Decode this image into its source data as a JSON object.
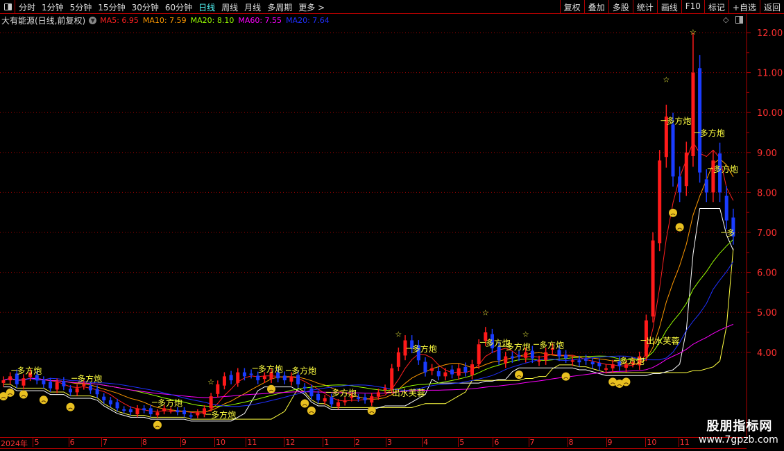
{
  "toolbar": {
    "periods": [
      "分时",
      "1分钟",
      "5分钟",
      "15分钟",
      "30分钟",
      "60分钟",
      "日线",
      "周线",
      "月线",
      "多周期",
      "更多 >"
    ],
    "active_period": "日线",
    "right_buttons": [
      "复权",
      "叠加",
      "多股",
      "统计",
      "画线",
      "F10",
      "标记",
      "+自选",
      "返回"
    ]
  },
  "title": {
    "stock": "大有能源(日线,前复权)",
    "ma": [
      {
        "text": "MA5: 6.95",
        "color": "#ff2020"
      },
      {
        "text": "MA10: 7.59",
        "color": "#ff9900"
      },
      {
        "text": "MA20: 8.10",
        "color": "#99ff00"
      },
      {
        "text": "MA60: 7.55",
        "color": "#ff00ff"
      },
      {
        "text": "MA20: 7.64",
        "color": "#2030ff"
      }
    ]
  },
  "watermark": {
    "cn": "股朋指标网",
    "url": "www.7gpzb.com"
  },
  "chart_data": {
    "type": "candlestick",
    "ylim": [
      2.2,
      12.4
    ],
    "y_ticks": [
      "12.00",
      "11.00",
      "10.00",
      "9.00",
      "8.00",
      "7.00",
      "6.00",
      "5.00",
      "4.00"
    ],
    "y_tick_values": [
      12,
      11,
      10,
      9,
      8,
      7,
      6,
      5,
      4
    ],
    "grid": "horizontal dotted",
    "x_month_labels": [
      {
        "label": "2024年",
        "bar": 0
      },
      {
        "label": "5",
        "bar": 4.4
      },
      {
        "label": "6",
        "bar": 9.7
      },
      {
        "label": "7",
        "bar": 14.6
      },
      {
        "label": "8",
        "bar": 20.5
      },
      {
        "label": "9",
        "bar": 26.4
      },
      {
        "label": "10",
        "bar": 31.5
      },
      {
        "label": "11",
        "bar": 36.2
      },
      {
        "label": "12",
        "bar": 41.9
      },
      {
        "label": "1",
        "bar": 47.7
      },
      {
        "label": "2",
        "bar": 52.3
      },
      {
        "label": "3",
        "bar": 57.1
      },
      {
        "label": "4",
        "bar": 62.5
      },
      {
        "label": "5",
        "bar": 67.9
      },
      {
        "label": "6",
        "bar": 73.1
      },
      {
        "label": "7",
        "bar": 78.4
      },
      {
        "label": "8",
        "bar": 84.2
      },
      {
        "label": "9",
        "bar": 90
      },
      {
        "label": "10",
        "bar": 95.9
      },
      {
        "label": "11",
        "bar": 100.8
      }
    ],
    "close": [
      3.3,
      3.4,
      3.2,
      3.35,
      3.5,
      3.3,
      3.2,
      3.1,
      3.25,
      3.15,
      3.0,
      3.1,
      3.2,
      3.05,
      2.95,
      2.8,
      2.7,
      2.6,
      2.55,
      2.5,
      2.6,
      2.55,
      2.45,
      2.5,
      2.6,
      2.55,
      2.5,
      2.45,
      2.4,
      2.5,
      2.6,
      2.9,
      3.2,
      3.4,
      3.3,
      3.5,
      3.4,
      3.45,
      3.3,
      3.4,
      3.5,
      3.35,
      3.3,
      3.4,
      3.2,
      3.1,
      2.9,
      2.8,
      2.85,
      2.7,
      2.75,
      2.8,
      2.9,
      2.85,
      2.8,
      2.9,
      3.0,
      3.1,
      3.6,
      4.0,
      4.3,
      4.1,
      3.8,
      3.5,
      3.6,
      3.4,
      3.5,
      3.45,
      3.6,
      3.5,
      3.7,
      4.2,
      4.5,
      4.1,
      3.8,
      3.9,
      3.85,
      3.9,
      4.0,
      3.85,
      3.8,
      4.0,
      4.1,
      3.9,
      3.85,
      3.8,
      3.75,
      3.8,
      3.7,
      3.65,
      3.6,
      3.7,
      3.65,
      3.7,
      3.75,
      3.9,
      4.8,
      6.8,
      8.8,
      9.9,
      8.4,
      8.0,
      9.0,
      11.0,
      8.5,
      8.0,
      8.8,
      8.0,
      7.3,
      6.9
    ],
    "spike_high": {
      "bar": 103,
      "value": 12.0
    },
    "series": [
      {
        "name": "MA5",
        "period": 5,
        "color": "#ff2020"
      },
      {
        "name": "MA10",
        "period": 10,
        "color": "#ff9900"
      },
      {
        "name": "MA20",
        "period": 20,
        "color": "#99ff00"
      },
      {
        "name": "MA60",
        "period": 60,
        "color": "#ff00ff"
      },
      {
        "name": "MA20",
        "period": 20,
        "color": "#2030ff",
        "offset": 3
      }
    ],
    "up_color": "#ff1a1a",
    "down_color": "#1a3cff",
    "annotations": [
      {
        "bar": 2,
        "price": 3.55,
        "text": "多方炮"
      },
      {
        "bar": 11,
        "price": 3.35,
        "text": "多方炮"
      },
      {
        "bar": 23,
        "price": 2.75,
        "text": "多方炮"
      },
      {
        "bar": 31,
        "price": 2.45,
        "text": "多方炮"
      },
      {
        "bar": 38,
        "price": 3.6,
        "text": "多方炮"
      },
      {
        "bar": 43,
        "price": 3.55,
        "text": "多方炮"
      },
      {
        "bar": 49,
        "price": 3.0,
        "text": "多方炮"
      },
      {
        "bar": 58,
        "price": 3.0,
        "text": "出水芙蓉"
      },
      {
        "bar": 61,
        "price": 4.1,
        "text": "多方炮"
      },
      {
        "bar": 72,
        "price": 4.25,
        "text": "多方炮"
      },
      {
        "bar": 75,
        "price": 4.15,
        "text": "多方炮"
      },
      {
        "bar": 80,
        "price": 4.2,
        "text": "多方炮"
      },
      {
        "bar": 96,
        "price": 4.3,
        "text": "出水芙蓉"
      },
      {
        "bar": 92,
        "price": 3.8,
        "text": "多方炮"
      },
      {
        "bar": 99,
        "price": 9.8,
        "text": "多方炮"
      },
      {
        "bar": 104,
        "price": 9.5,
        "text": "多方炮"
      },
      {
        "bar": 106,
        "price": 8.6,
        "text": "多方炮"
      },
      {
        "bar": 108,
        "price": 7.0,
        "text": "多"
      }
    ],
    "stars": [
      31,
      59,
      72,
      78,
      99,
      103
    ],
    "sad_faces": [
      0,
      1,
      3,
      6,
      10,
      23,
      40,
      45,
      46,
      55,
      77,
      84,
      91,
      92,
      93,
      100,
      101
    ]
  }
}
